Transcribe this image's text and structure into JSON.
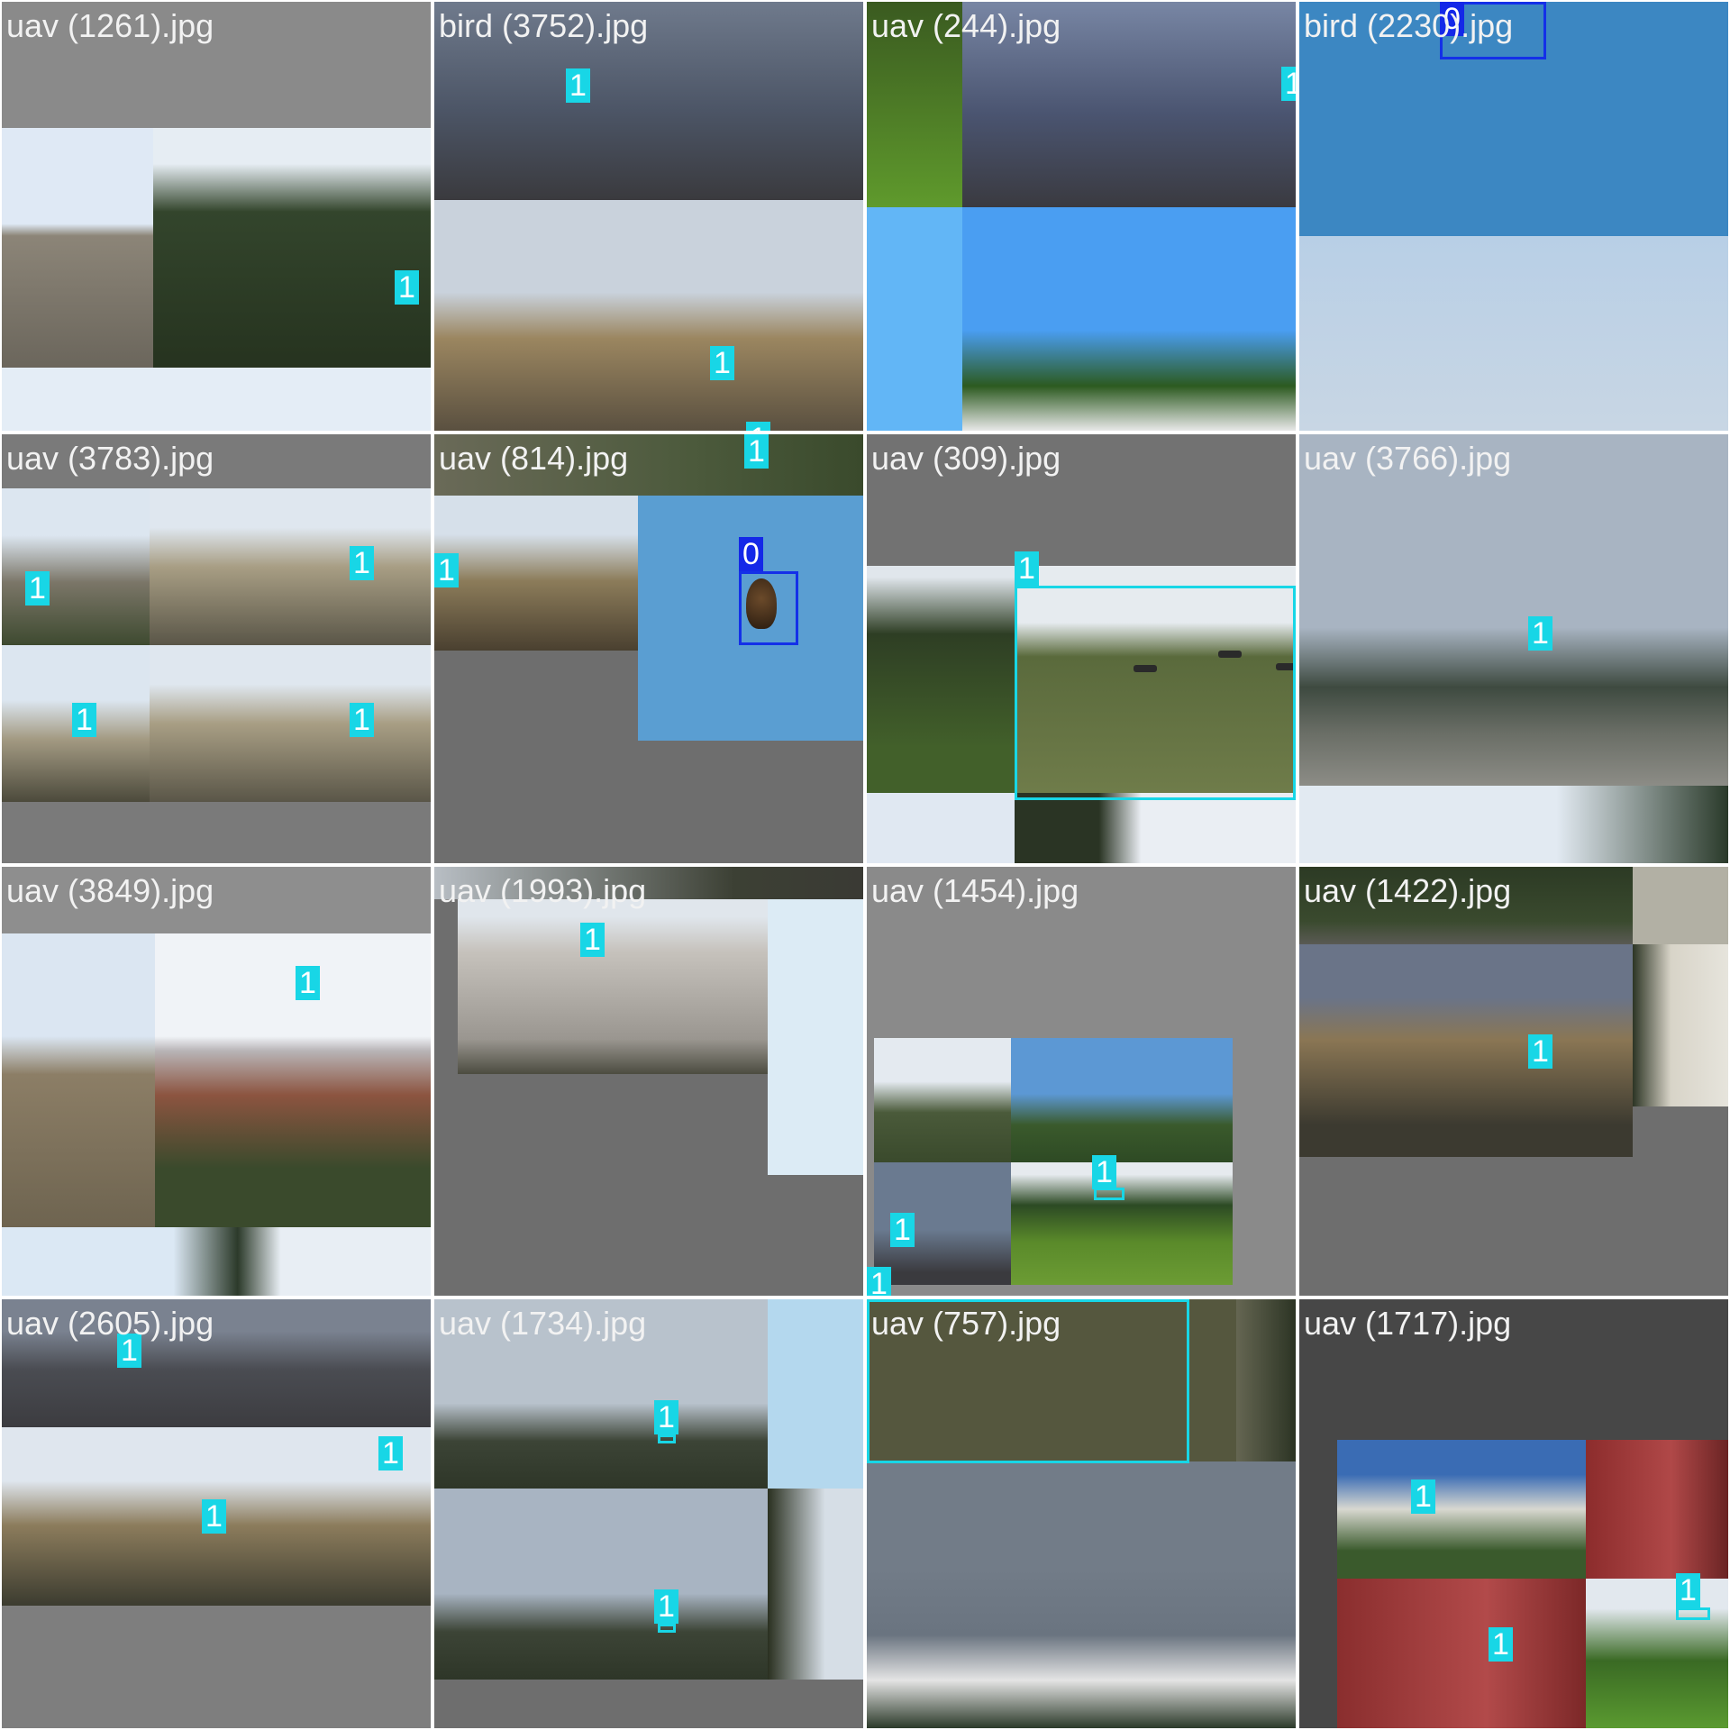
{
  "colors": {
    "class_0_box": "#1428e8",
    "class_1_box": "#18d6e6",
    "padding_gray": "#727272",
    "filename_text": "#f2f2f2"
  },
  "tiles": [
    {
      "filename": "uav (1261).jpg"
    },
    {
      "filename": "bird (3752).jpg"
    },
    {
      "filename": "uav (244).jpg"
    },
    {
      "filename": "bird (2230).jpg"
    },
    {
      "filename": "uav (3783).jpg"
    },
    {
      "filename": "uav (814).jpg"
    },
    {
      "filename": "uav (309).jpg"
    },
    {
      "filename": "uav (3766).jpg"
    },
    {
      "filename": "uav (3849).jpg"
    },
    {
      "filename": "uav (1993).jpg"
    },
    {
      "filename": "uav (1454).jpg"
    },
    {
      "filename": "uav (1422).jpg"
    },
    {
      "filename": "uav (2605).jpg"
    },
    {
      "filename": "uav (1734).jpg"
    },
    {
      "filename": "uav (757).jpg"
    },
    {
      "filename": "uav (1717).jpg"
    }
  ],
  "labels": {
    "class_0": "0",
    "class_1": "1"
  }
}
